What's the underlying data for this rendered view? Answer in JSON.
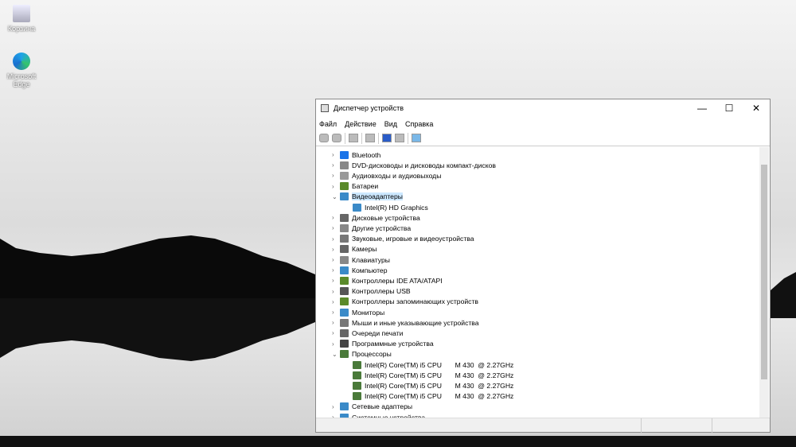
{
  "desktop": {
    "icons": [
      {
        "label": "Корзина",
        "icon": "recycle-bin-icon"
      },
      {
        "label": "Microsoft Edge",
        "icon": "edge-icon"
      }
    ]
  },
  "window": {
    "title": "Диспетчер устройств",
    "controls": {
      "minimize": "—",
      "maximize": "☐",
      "close": "✕"
    },
    "menu": [
      "Файл",
      "Действие",
      "Вид",
      "Справка"
    ],
    "tree": [
      {
        "label": "Bluetooth",
        "level": 0,
        "expanded": false,
        "color": "#1a73e8"
      },
      {
        "label": "DVD-дисководы и дисководы компакт-дисков",
        "level": 0,
        "expanded": false,
        "color": "#888"
      },
      {
        "label": "Аудиовходы и аудиовыходы",
        "level": 0,
        "expanded": false,
        "color": "#999"
      },
      {
        "label": "Батареи",
        "level": 0,
        "expanded": false,
        "color": "#5a8a2a"
      },
      {
        "label": "Видеоадаптеры",
        "level": 0,
        "expanded": true,
        "selected": true,
        "color": "#3a8ac8"
      },
      {
        "label": "Intel(R) HD Graphics",
        "level": 1,
        "color": "#3a8ac8"
      },
      {
        "label": "Дисковые устройства",
        "level": 0,
        "expanded": false,
        "color": "#666"
      },
      {
        "label": "Другие устройства",
        "level": 0,
        "expanded": false,
        "color": "#888"
      },
      {
        "label": "Звуковые, игровые и видеоустройства",
        "level": 0,
        "expanded": false,
        "color": "#777"
      },
      {
        "label": "Камеры",
        "level": 0,
        "expanded": false,
        "color": "#666"
      },
      {
        "label": "Клавиатуры",
        "level": 0,
        "expanded": false,
        "color": "#888"
      },
      {
        "label": "Компьютер",
        "level": 0,
        "expanded": false,
        "color": "#3a8ac8"
      },
      {
        "label": "Контроллеры IDE ATA/ATAPI",
        "level": 0,
        "expanded": false,
        "color": "#5a8a2a"
      },
      {
        "label": "Контроллеры USB",
        "level": 0,
        "expanded": false,
        "color": "#555"
      },
      {
        "label": "Контроллеры запоминающих устройств",
        "level": 0,
        "expanded": false,
        "color": "#5a8a2a"
      },
      {
        "label": "Мониторы",
        "level": 0,
        "expanded": false,
        "color": "#3a8ac8"
      },
      {
        "label": "Мыши и иные указывающие устройства",
        "level": 0,
        "expanded": false,
        "color": "#777"
      },
      {
        "label": "Очереди печати",
        "level": 0,
        "expanded": false,
        "color": "#666"
      },
      {
        "label": "Программные устройства",
        "level": 0,
        "expanded": false,
        "color": "#444"
      },
      {
        "label": "Процессоры",
        "level": 0,
        "expanded": true,
        "color": "#4a7a3a"
      },
      {
        "label": "Intel(R) Core(TM) i5 CPU       M 430  @ 2.27GHz",
        "level": 1,
        "color": "#4a7a3a"
      },
      {
        "label": "Intel(R) Core(TM) i5 CPU       M 430  @ 2.27GHz",
        "level": 1,
        "color": "#4a7a3a"
      },
      {
        "label": "Intel(R) Core(TM) i5 CPU       M 430  @ 2.27GHz",
        "level": 1,
        "color": "#4a7a3a"
      },
      {
        "label": "Intel(R) Core(TM) i5 CPU       M 430  @ 2.27GHz",
        "level": 1,
        "color": "#4a7a3a"
      },
      {
        "label": "Сетевые адаптеры",
        "level": 0,
        "expanded": false,
        "color": "#3a8ac8"
      },
      {
        "label": "Системные устройства",
        "level": 0,
        "expanded": false,
        "color": "#3a8ac8"
      }
    ]
  }
}
